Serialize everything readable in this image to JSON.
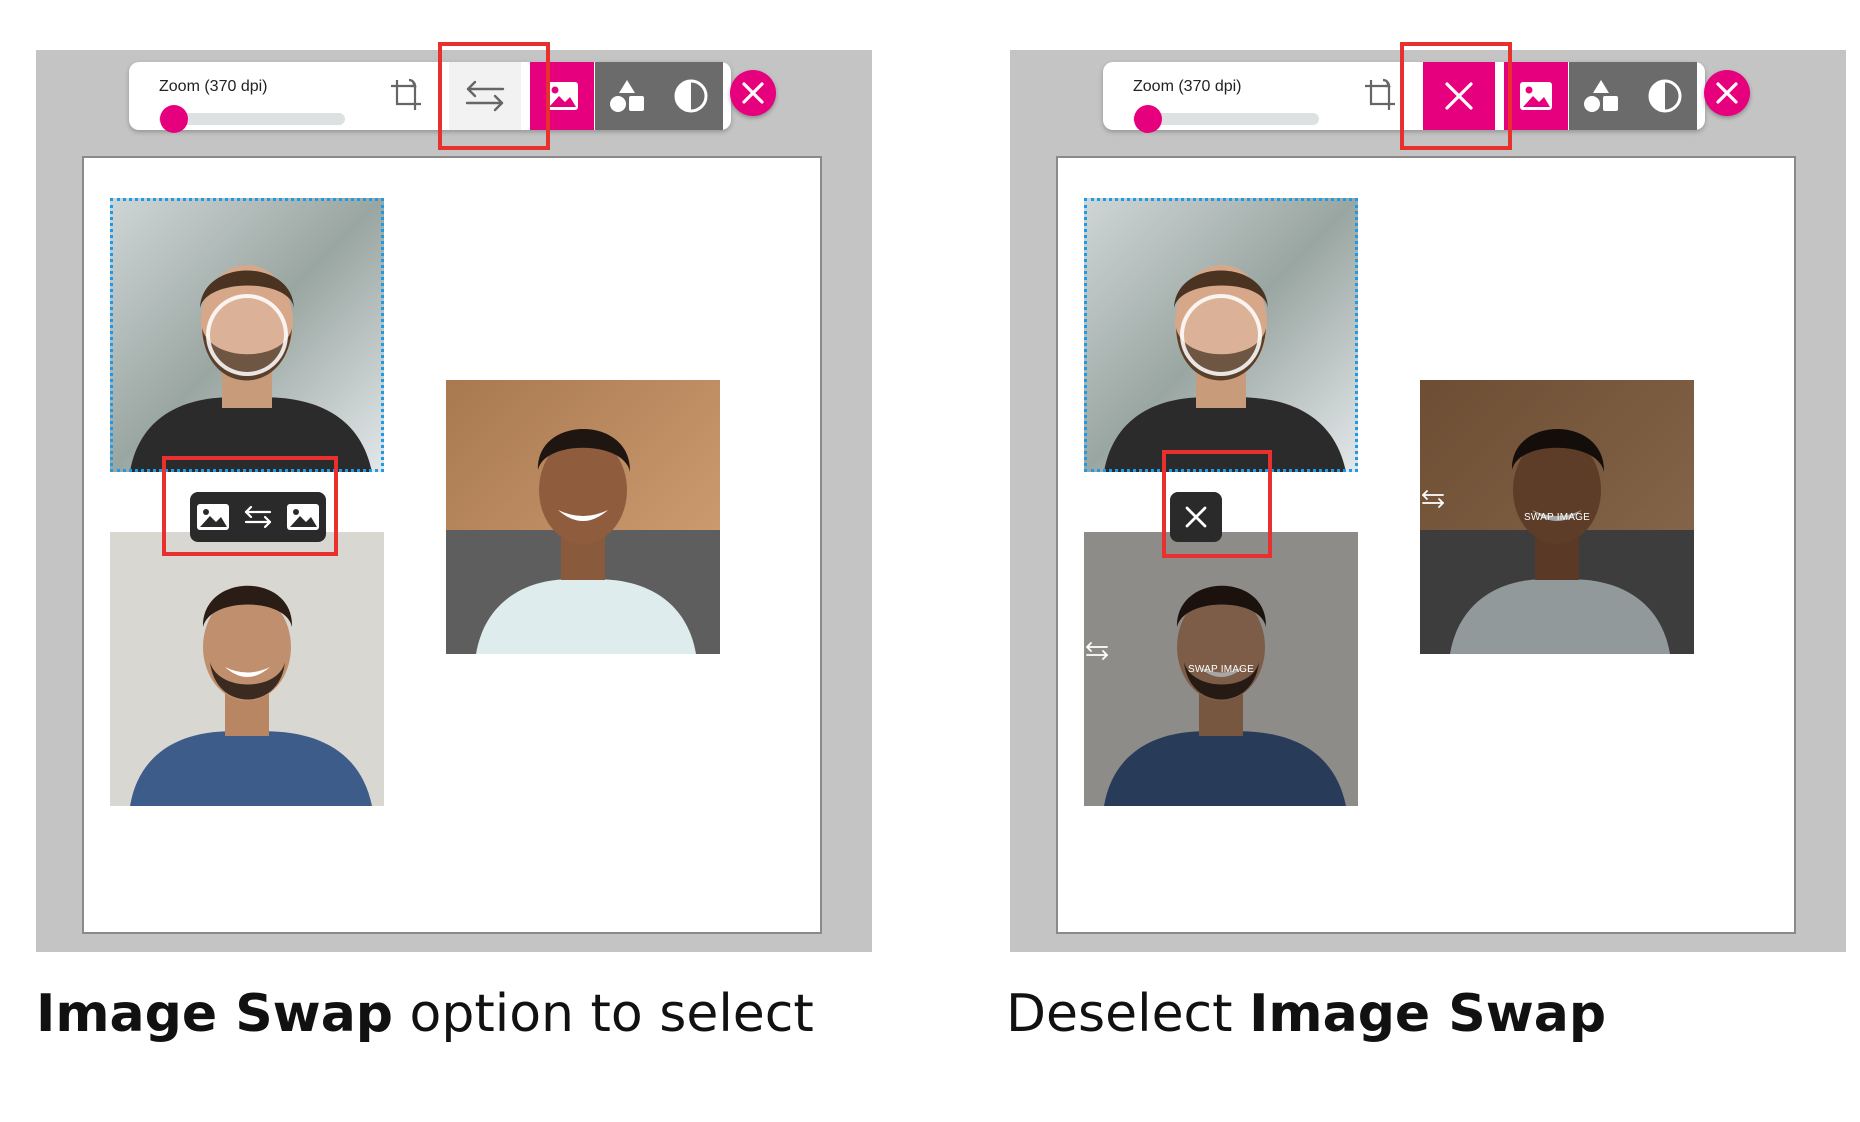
{
  "toolbar": {
    "zoom_label": "Zoom (370 dpi)",
    "zoom_value_fraction": 0.08
  },
  "panels": [
    {
      "state": "swap-option-available"
    },
    {
      "state": "swap-mode-active"
    }
  ],
  "photos": {
    "overlay_label": "SWAP IMAGE"
  },
  "captions": {
    "left_bold": "Image Swap",
    "left_rest": " option to select",
    "right_prefix": "Deselect ",
    "right_bold": "Image Swap"
  },
  "colors": {
    "accent": "#e6007e",
    "highlight": "#e8312f",
    "selection": "#1e9be8",
    "toolbar_dark": "#6b6b6b"
  },
  "icons": [
    "crop-icon",
    "swap-arrows-icon",
    "image-icon",
    "shapes-icon",
    "contrast-icon",
    "close-icon"
  ]
}
